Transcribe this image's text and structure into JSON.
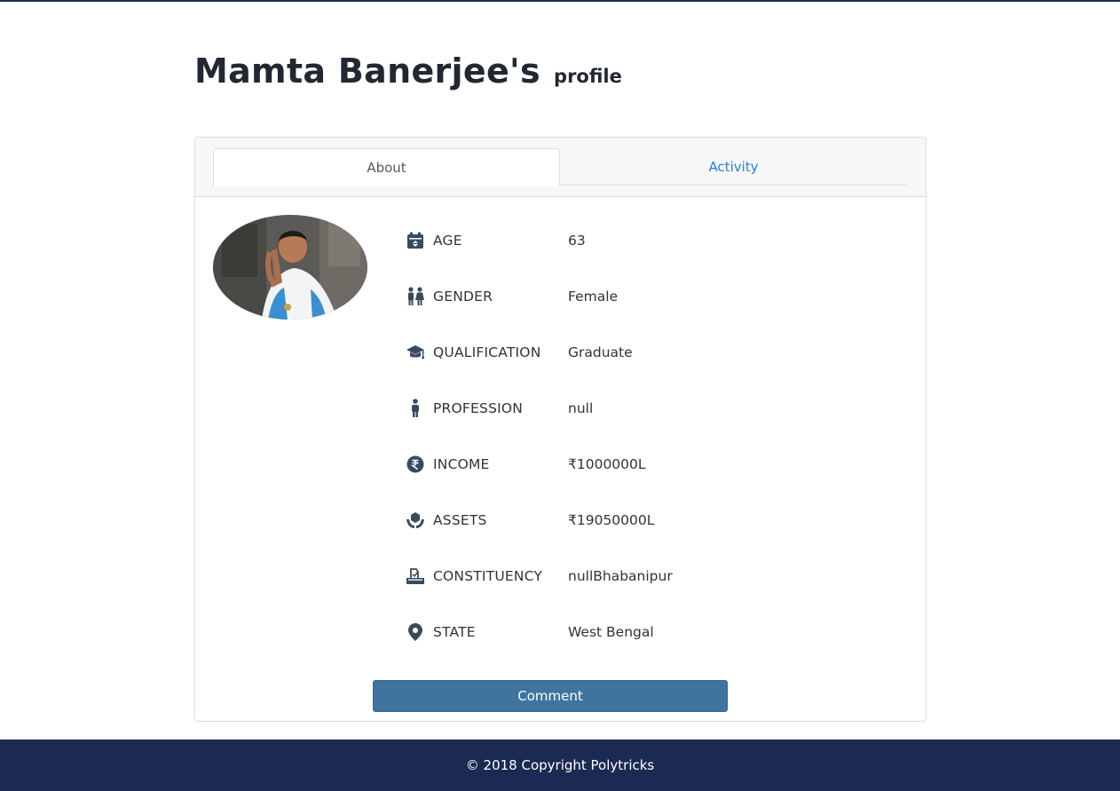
{
  "page": {
    "title_name": "Mamta Banerjee's",
    "title_suffix": "profile"
  },
  "tabs": [
    {
      "label": "About",
      "active": true
    },
    {
      "label": "Activity",
      "active": false
    }
  ],
  "profile": {
    "rows": [
      {
        "icon": "calendar-icon",
        "label": "AGE",
        "value": "63"
      },
      {
        "icon": "gender-icon",
        "label": "GENDER",
        "value": "Female"
      },
      {
        "icon": "graduation-cap-icon",
        "label": "QUALIFICATION",
        "value": "Graduate"
      },
      {
        "icon": "person-icon",
        "label": "PROFESSION",
        "value": "null"
      },
      {
        "icon": "rupee-coin-icon",
        "label": "INCOME",
        "value": "₹1000000L"
      },
      {
        "icon": "assets-hands-icon",
        "label": "ASSETS",
        "value": "₹19050000L"
      },
      {
        "icon": "voting-box-icon",
        "label": "CONSTITUENCY",
        "value": "nullBhabanipur"
      },
      {
        "icon": "map-pin-icon",
        "label": "STATE",
        "value": "West Bengal"
      }
    ]
  },
  "actions": {
    "comment_label": "Comment"
  },
  "footer": {
    "text": "© 2018 Copyright Polytricks"
  },
  "colors": {
    "navy": "#1b2a52",
    "link_blue": "#2a7fd4",
    "button_blue": "#3f74a0",
    "icon": "#3a4a5c"
  }
}
